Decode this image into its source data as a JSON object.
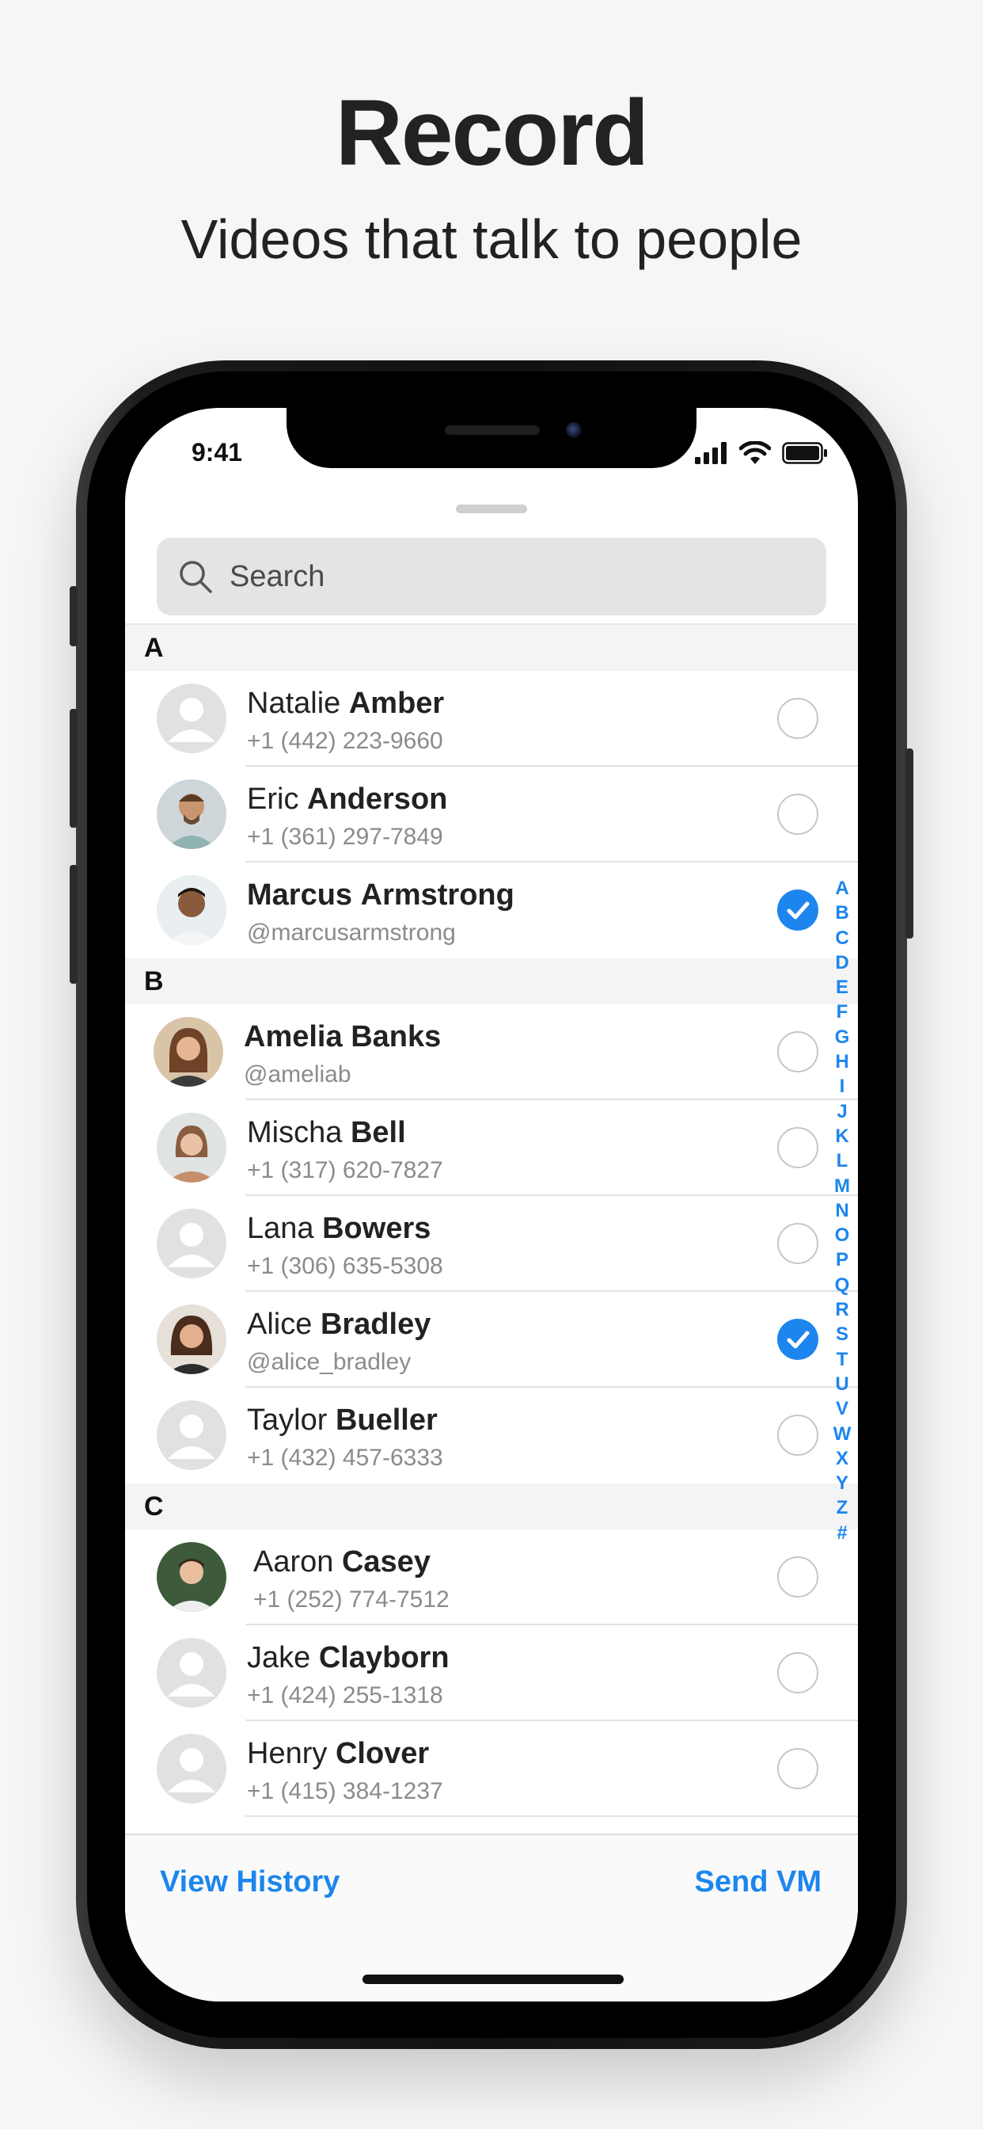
{
  "marketing": {
    "headline": "Record",
    "subheadline": "Videos that talk to people"
  },
  "status_bar": {
    "time": "9:41"
  },
  "search": {
    "placeholder": "Search"
  },
  "sections": [
    {
      "letter": "A",
      "contacts": [
        {
          "first": "Natalie",
          "last": "Amber",
          "detail": "+1 (442) 223-9660",
          "selected": false,
          "avatar": "placeholder"
        },
        {
          "first": "Eric",
          "last": "Anderson",
          "detail": "+1 (361) 297-7849",
          "selected": false,
          "avatar": "photo"
        },
        {
          "first": "Marcus",
          "last": "Armstrong",
          "detail": "@marcusarmstrong",
          "selected": true,
          "avatar": "photo",
          "bold_first": true
        }
      ]
    },
    {
      "letter": "B",
      "contacts": [
        {
          "first": "Amelia",
          "last": "Banks",
          "detail": "@ameliab",
          "selected": false,
          "avatar": "photo",
          "bold_first": true
        },
        {
          "first": "Mischa",
          "last": "Bell",
          "detail": "+1 (317) 620-7827",
          "selected": false,
          "avatar": "photo"
        },
        {
          "first": "Lana",
          "last": "Bowers",
          "detail": "+1 (306) 635-5308",
          "selected": false,
          "avatar": "placeholder"
        },
        {
          "first": "Alice",
          "last": "Bradley",
          "detail": "@alice_bradley",
          "selected": true,
          "avatar": "photo"
        },
        {
          "first": "Taylor",
          "last": "Bueller",
          "detail": "+1 (432) 457-6333",
          "selected": false,
          "avatar": "placeholder"
        }
      ]
    },
    {
      "letter": "C",
      "contacts": [
        {
          "first": "Aaron",
          "last": "Casey",
          "detail": "+1 (252) 774-7512",
          "selected": false,
          "avatar": "photo"
        },
        {
          "first": "Jake",
          "last": "Clayborn",
          "detail": "+1 (424) 255-1318",
          "selected": false,
          "avatar": "placeholder"
        },
        {
          "first": "Henry",
          "last": "Clover",
          "detail": "+1 (415) 384-1237",
          "selected": false,
          "avatar": "placeholder"
        }
      ]
    }
  ],
  "alpha_index": [
    "A",
    "B",
    "C",
    "D",
    "E",
    "F",
    "G",
    "H",
    "I",
    "J",
    "K",
    "L",
    "M",
    "N",
    "O",
    "P",
    "Q",
    "R",
    "S",
    "T",
    "U",
    "V",
    "W",
    "X",
    "Y",
    "Z",
    "#"
  ],
  "actions": {
    "view_history": "View History",
    "send_vm": "Send VM"
  },
  "colors": {
    "accent": "#1c86ee",
    "text": "#222222",
    "secondary_text": "#8b8b8b"
  }
}
